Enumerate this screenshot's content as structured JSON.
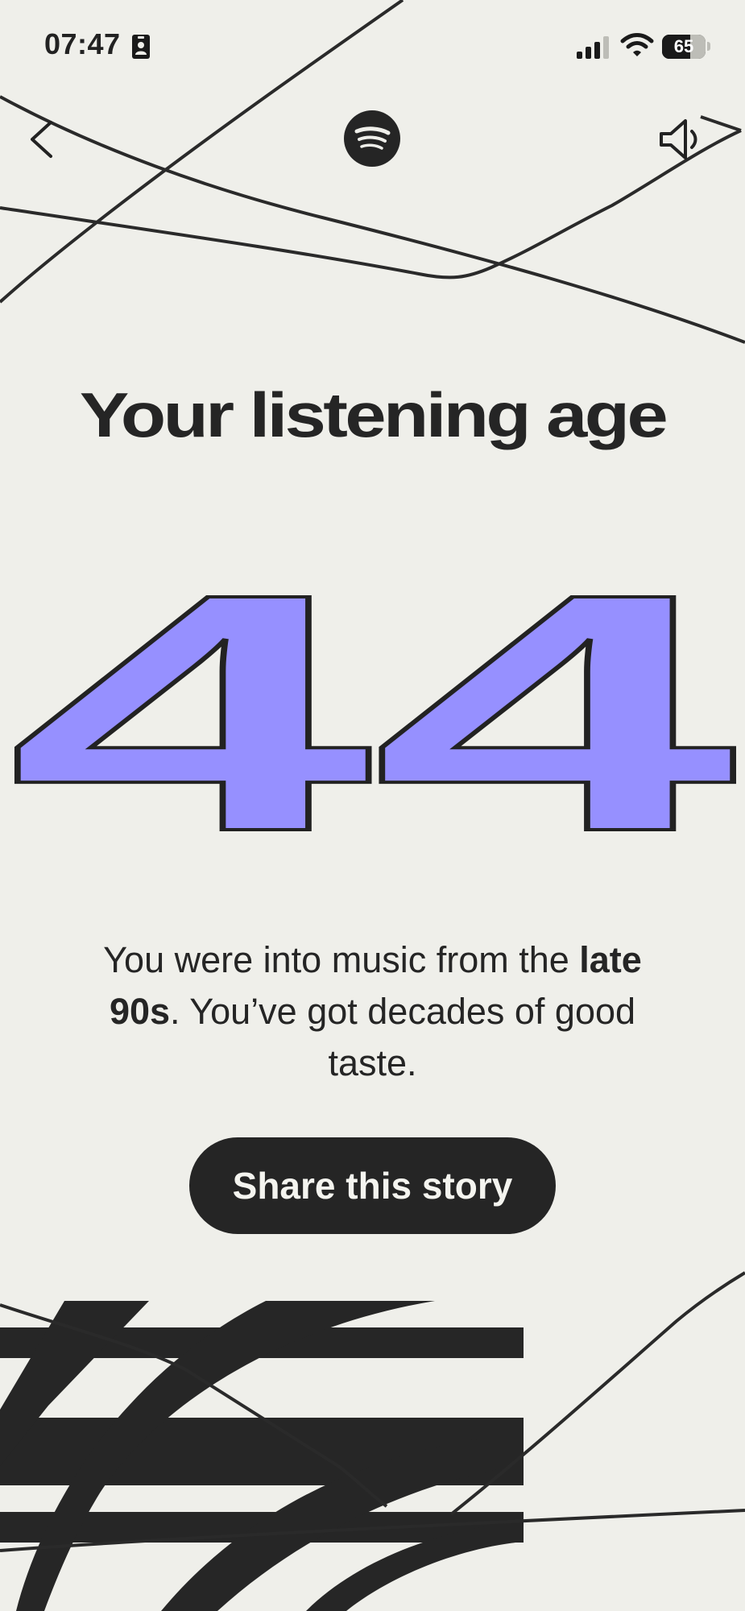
{
  "status_bar": {
    "time": "07:47",
    "battery": "65",
    "battery_level": 0.65,
    "icons": [
      "id-badge-icon",
      "cellular-signal-icon",
      "wifi-icon",
      "battery-icon"
    ]
  },
  "top_bar": {
    "back_icon": "chevron-left-icon",
    "logo_icon": "spotify-logo-icon",
    "volume_icon": "speaker-icon"
  },
  "story": {
    "title": "Your listening age",
    "age": "44",
    "description": {
      "part1": "You were into music from the ",
      "bold1": "late 90s",
      "part2": ". You’ve got decades of good taste."
    },
    "share_label": "Share this story"
  },
  "colors": {
    "background": "#efefea",
    "accent": "#9690ff",
    "ink": "#252525"
  }
}
